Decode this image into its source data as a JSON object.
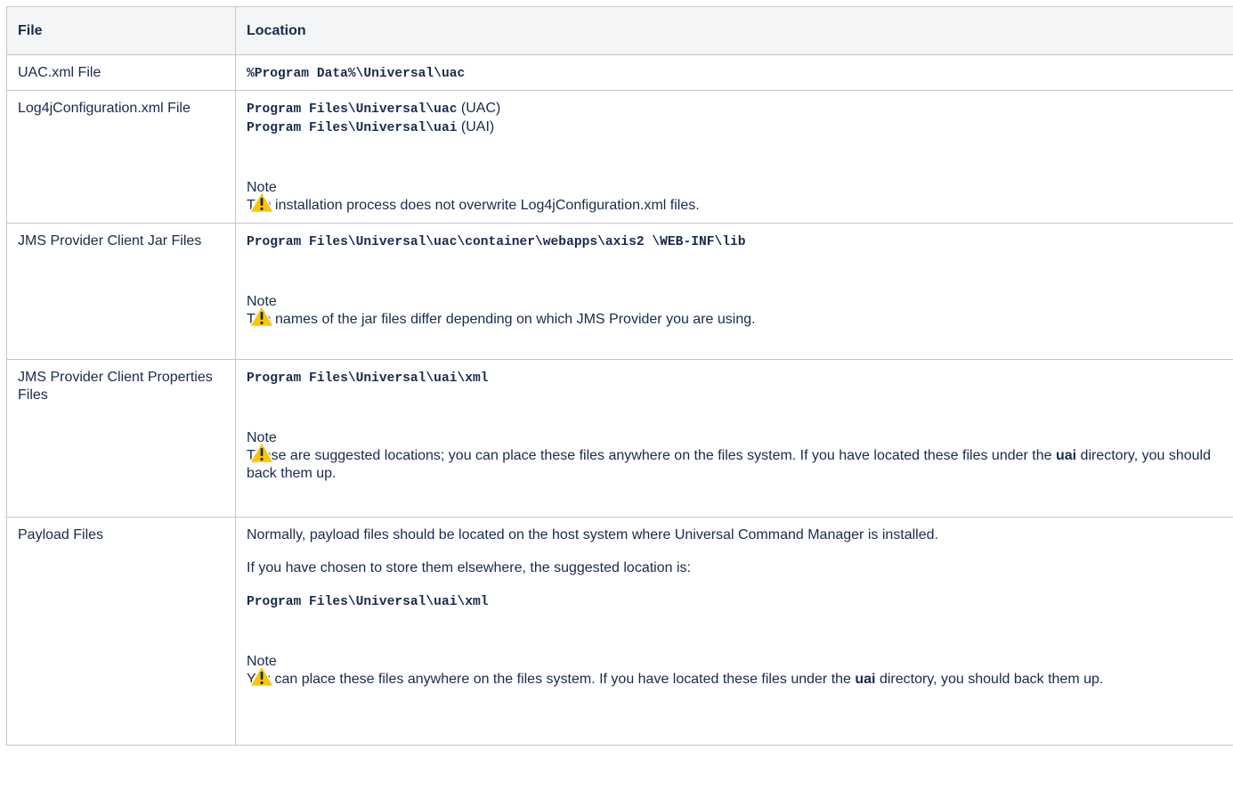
{
  "table": {
    "headers": [
      "File",
      "Location"
    ],
    "rows": [
      {
        "file": "UAC.xml File",
        "location": "%Program Data%\\Universal\\uac"
      },
      {
        "file": "Log4jConfiguration.xml File",
        "lines": [
          {
            "path": "Program Files\\Universal\\uac",
            "suffix": " (UAC)"
          },
          {
            "path": "Program Files\\Universal\\uai",
            "suffix": " (UAI)"
          }
        ],
        "note_title": "Note",
        "note_text": "The installation process does not overwrite Log4jConfiguration.xml files."
      },
      {
        "file": "JMS Provider Client Jar Files",
        "path": "Program Files\\Universal\\uac\\container\\webapps\\axis2 \\WEB-INF\\lib",
        "note_title": "Note",
        "note_text": "The names of the jar files differ depending on which JMS Provider you are using."
      },
      {
        "file": "JMS Provider Client Properties Files",
        "path": "Program Files\\Universal\\uai\\xml",
        "note_title": "Note",
        "note_pre": "These are suggested locations; you can place these files anywhere on the files system. If you have located these files under the ",
        "note_bold": "uai",
        "note_post": " directory, you should back them up."
      },
      {
        "file": "Payload Files",
        "para1": "Normally, payload files should be located on the host system where Universal Command Manager is installed.",
        "para2": "If you have chosen to store them elsewhere, the suggested location is:",
        "path": "Program Files\\Universal\\uai\\xml",
        "note_title": "Note",
        "note_pre": "You can place these files anywhere on the files system. If you have located these files under the ",
        "note_bold": "uai",
        "note_post": " directory, you should back them up."
      }
    ]
  },
  "icons": {
    "note": "warning-icon"
  },
  "colors": {
    "warning_fill": "#ffc400",
    "warning_mark": "#172b4d",
    "border": "#c1c7d0",
    "header_bg": "#f4f5f7"
  }
}
